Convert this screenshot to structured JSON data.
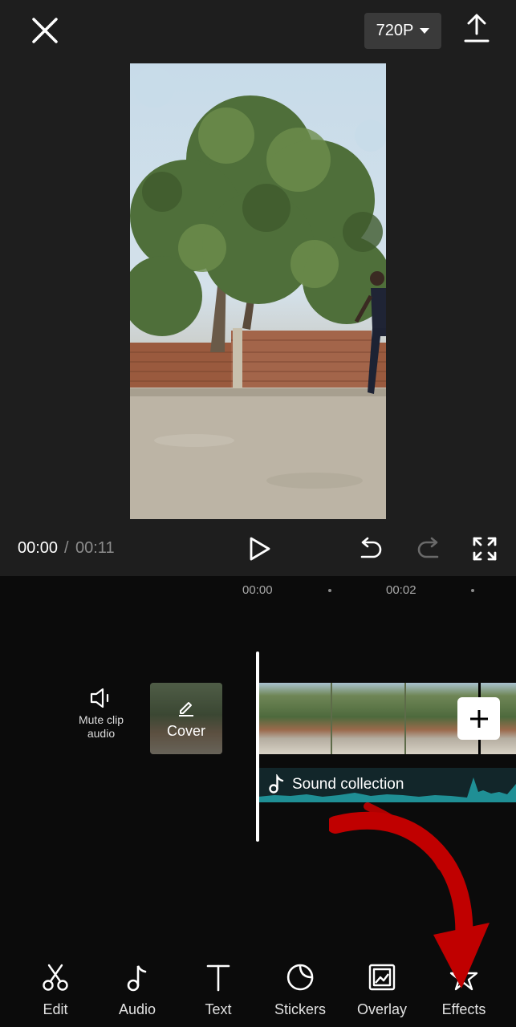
{
  "header": {
    "close_icon": "close-icon",
    "resolution": "720P",
    "export_icon": "upload-icon"
  },
  "player": {
    "current_time": "00:00",
    "separator": "/",
    "total_time": "00:11"
  },
  "ruler": {
    "marks": [
      "00:00",
      "00:02"
    ]
  },
  "timeline": {
    "mute_label": "Mute clip\naudio",
    "cover_label": "Cover",
    "audio_label": "Sound collection"
  },
  "toolbar": {
    "items": [
      {
        "label": "Edit",
        "icon": "scissors-icon"
      },
      {
        "label": "Audio",
        "icon": "music-note-icon"
      },
      {
        "label": "Text",
        "icon": "text-icon"
      },
      {
        "label": "Stickers",
        "icon": "sticker-icon"
      },
      {
        "label": "Overlay",
        "icon": "overlay-icon"
      },
      {
        "label": "Effects",
        "icon": "effects-star-icon"
      }
    ]
  },
  "colors": {
    "background": "#0b0b0b",
    "top_area": "#1e1e1e",
    "audio_wave": "#1f8f95",
    "annotation_arrow": "#c00000"
  }
}
